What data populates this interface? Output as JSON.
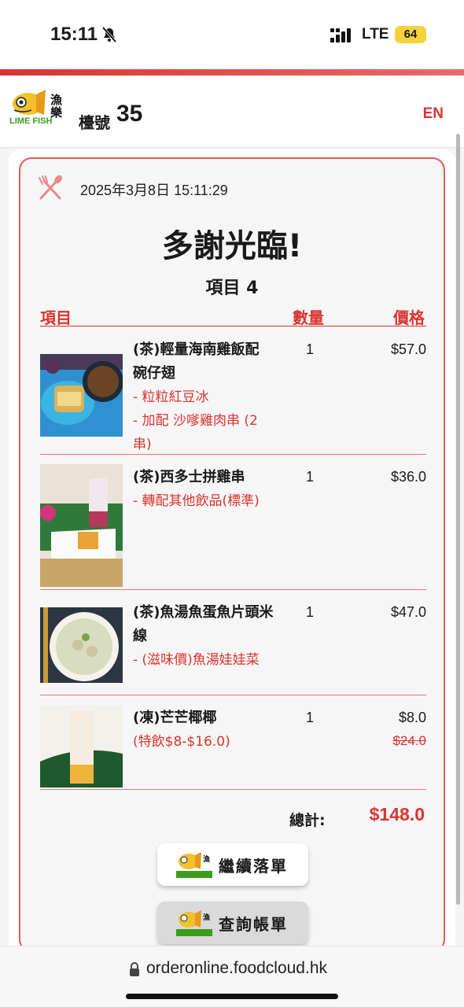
{
  "status": {
    "time": "15:11",
    "network": "LTE",
    "battery": "64"
  },
  "header": {
    "brand": "LIME FISH",
    "table_label": "檯號",
    "table_number": "35",
    "lang": "EN"
  },
  "receipt": {
    "datetime": "2025年3月8日 15:11:29",
    "thanks": "多謝光臨!",
    "item_count": "項目 4",
    "columns": {
      "item": "項目",
      "qty": "數量",
      "price": "價格"
    },
    "items": [
      {
        "name": "(茶)輕量海南雞飯配 碗仔翅",
        "options": [
          "- 粒粒紅豆冰",
          "- 加配 沙嗲雞肉串 (2串)"
        ],
        "qty": "1",
        "price": "$57.0"
      },
      {
        "name": "(茶)西多士拼雞串",
        "options": [
          "- 轉配其他飲品(標準)"
        ],
        "qty": "1",
        "price": "$36.0"
      },
      {
        "name": "(茶)魚湯魚蛋魚片頭米線",
        "options": [
          "- (滋味價)魚湯娃娃菜"
        ],
        "qty": "1",
        "price": "$47.0"
      },
      {
        "name": "(凍)芒芒椰椰",
        "options": [
          "(特飲$8-$16.0)"
        ],
        "qty": "1",
        "price": "$8.0",
        "old_price": "$24.0"
      }
    ],
    "total_label": "總計:",
    "total_value": "$148.0",
    "continue_label": "繼續落單",
    "bill_label": "查詢帳單"
  },
  "browser": {
    "url": "orderonline.foodcloud.hk"
  },
  "colors": {
    "accent": "#d9342f",
    "brand_green": "#3b9c1c",
    "brand_yellow": "#f2c12e"
  }
}
